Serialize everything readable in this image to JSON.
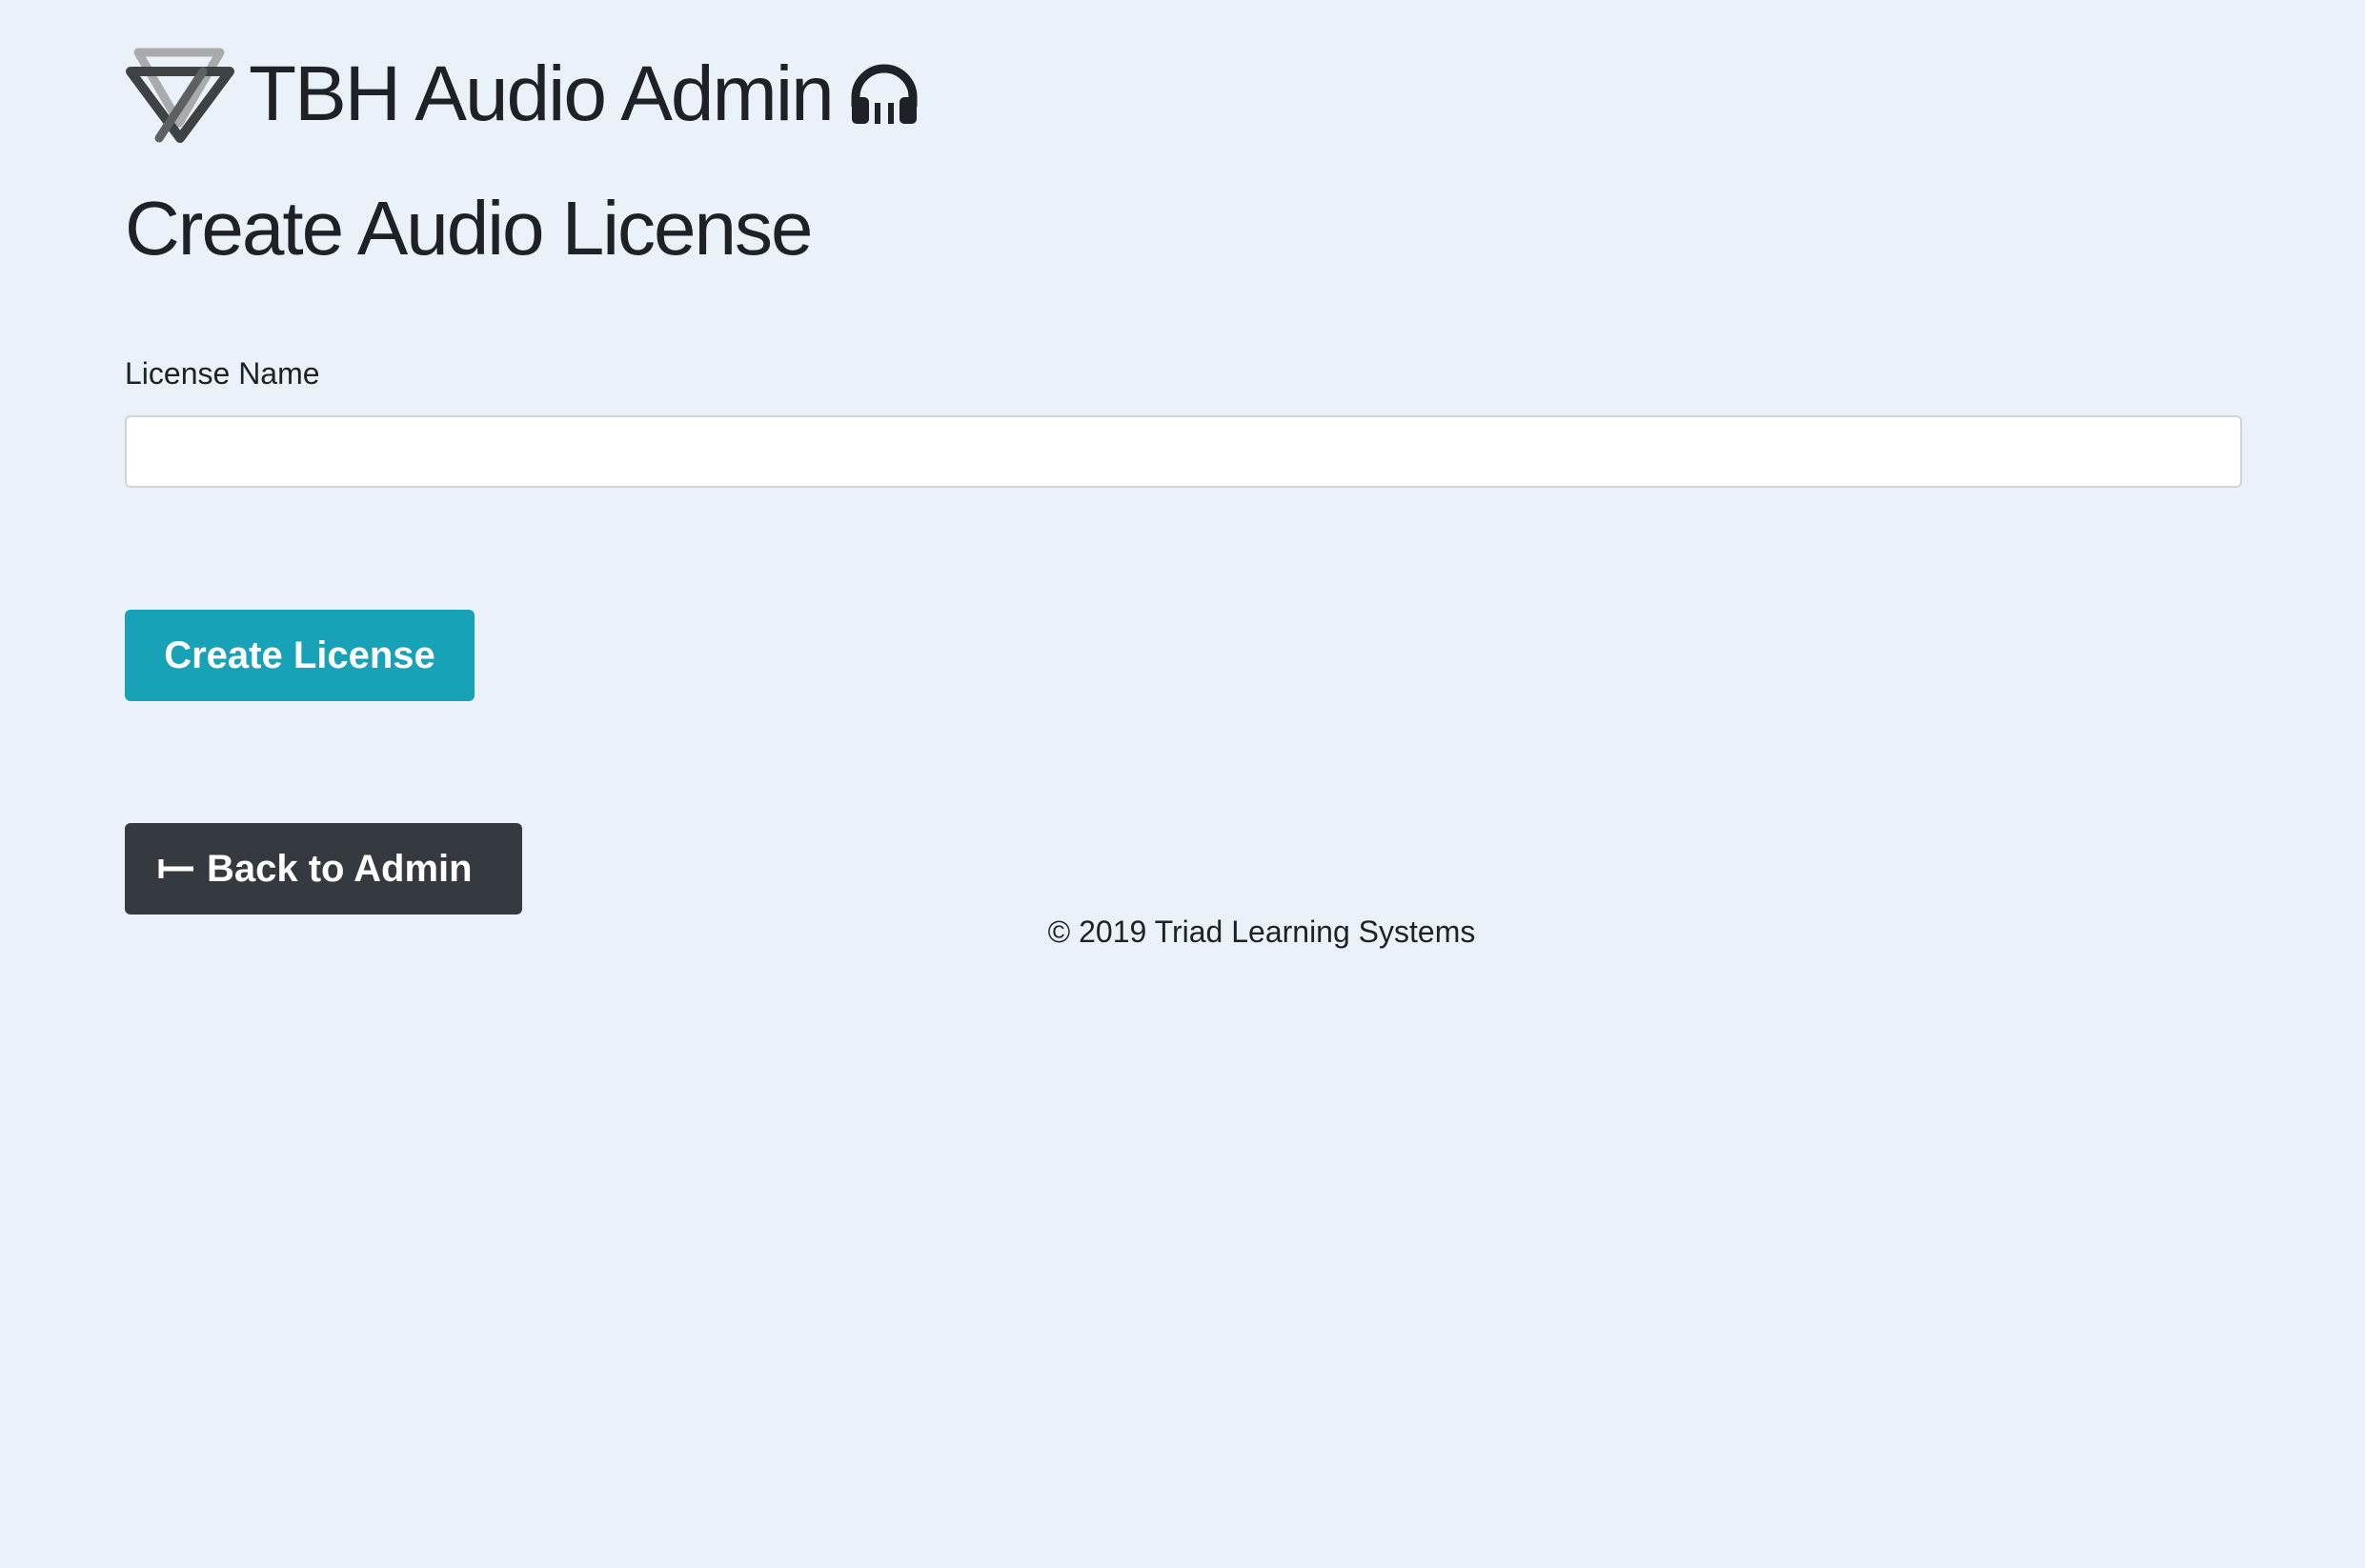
{
  "header": {
    "app_title": "TBH Audio Admin",
    "logo_icon": "triad-triangles-logo",
    "title_icon": "headphones-icon"
  },
  "page": {
    "title": "Create Audio License"
  },
  "form": {
    "license_name_label": "License Name",
    "license_name_value": "",
    "license_name_placeholder": "",
    "submit_label": "Create License"
  },
  "nav": {
    "back_label": "Back to Admin",
    "back_icon": "arrow-left-icon"
  },
  "footer": {
    "copyright": "© 2019 Triad Learning Systems"
  },
  "colors": {
    "background": "#eaf1f8",
    "primary_button": "#17a2b8",
    "dark_button": "#343a40",
    "text": "#1e2125"
  }
}
